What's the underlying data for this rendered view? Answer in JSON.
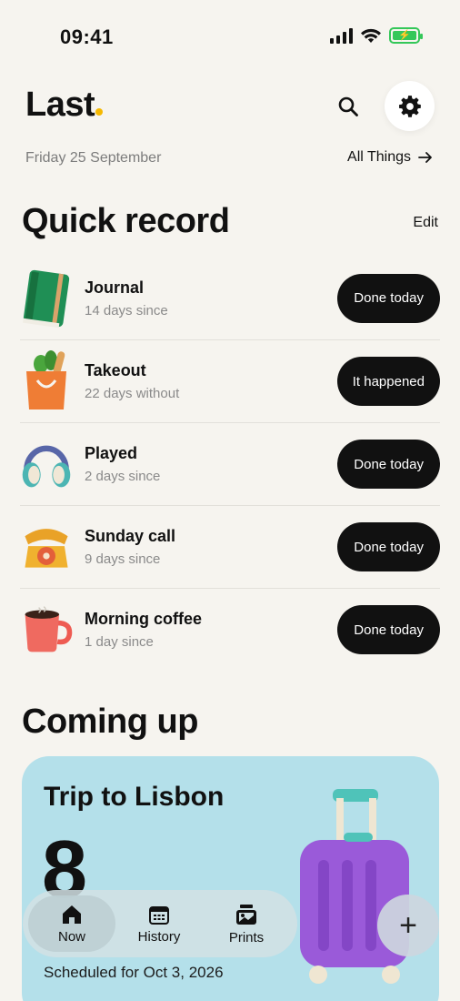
{
  "status_bar": {
    "time": "09:41",
    "icons": [
      "signal-icon",
      "wifi-icon",
      "battery-charging-icon"
    ]
  },
  "header": {
    "logo_text": "Last",
    "logo_dot_color": "#f5b800",
    "date": "Friday 25 September",
    "all_things_label": "All Things"
  },
  "quick_record": {
    "title": "Quick record",
    "edit_label": "Edit",
    "items": [
      {
        "icon": "journal-icon",
        "title": "Journal",
        "subtitle": "14 days since",
        "action": "Done today"
      },
      {
        "icon": "takeout-bag-icon",
        "title": "Takeout",
        "subtitle": "22 days without",
        "action": "It happened"
      },
      {
        "icon": "headphones-icon",
        "title": "Played",
        "subtitle": "2 days since",
        "action": "Done today"
      },
      {
        "icon": "telephone-icon",
        "title": "Sunday call",
        "subtitle": "9 days since",
        "action": "Done today"
      },
      {
        "icon": "coffee-mug-icon",
        "title": "Morning coffee",
        "subtitle": "1 day since",
        "action": "Done today"
      }
    ]
  },
  "coming_up": {
    "title": "Coming up",
    "card": {
      "title": "Trip to Lisbon",
      "count": "8",
      "scheduled": "Scheduled for Oct 3, 2026",
      "icon": "suitcase-icon",
      "color": "#b4e0ea"
    }
  },
  "nav": {
    "items": [
      {
        "label": "Now",
        "icon": "home-icon",
        "active": true
      },
      {
        "label": "History",
        "icon": "calendar-icon",
        "active": false
      },
      {
        "label": "Prints",
        "icon": "prints-icon",
        "active": false
      }
    ],
    "add_label": "+"
  }
}
